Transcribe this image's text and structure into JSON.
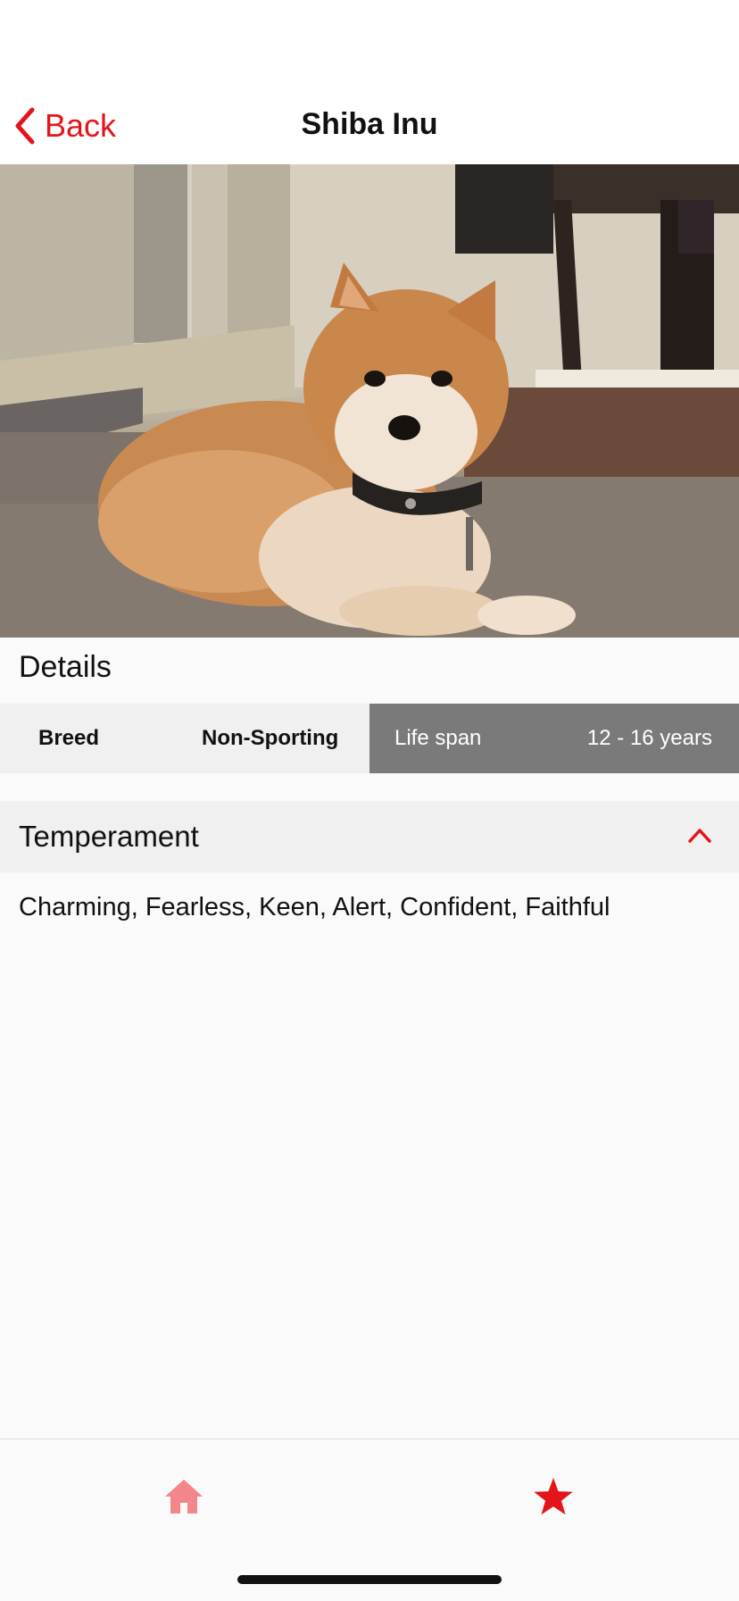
{
  "navigation": {
    "back_label": "Back",
    "title": "Shiba Inu"
  },
  "hero": {
    "image_subject": "Shiba Inu dog lying on carpet"
  },
  "details": {
    "title": "Details",
    "breed_key": "Breed",
    "breed_value": "Non-Sporting",
    "life_span_key": "Life span",
    "life_span_value": "12 - 16 years"
  },
  "temperament": {
    "title": "Temperament",
    "expanded": true,
    "text": "Charming, Fearless, Keen, Alert, Confident, Faithful"
  },
  "tabbar": {
    "tabs": [
      {
        "icon": "home-icon",
        "active": false
      },
      {
        "icon": "star-icon",
        "active": true
      }
    ]
  },
  "colors": {
    "accent": "#e5141b",
    "accent_inactive": "#f3868a",
    "strip_light": "#f0f0f0",
    "strip_dark": "#7a7a7a"
  }
}
